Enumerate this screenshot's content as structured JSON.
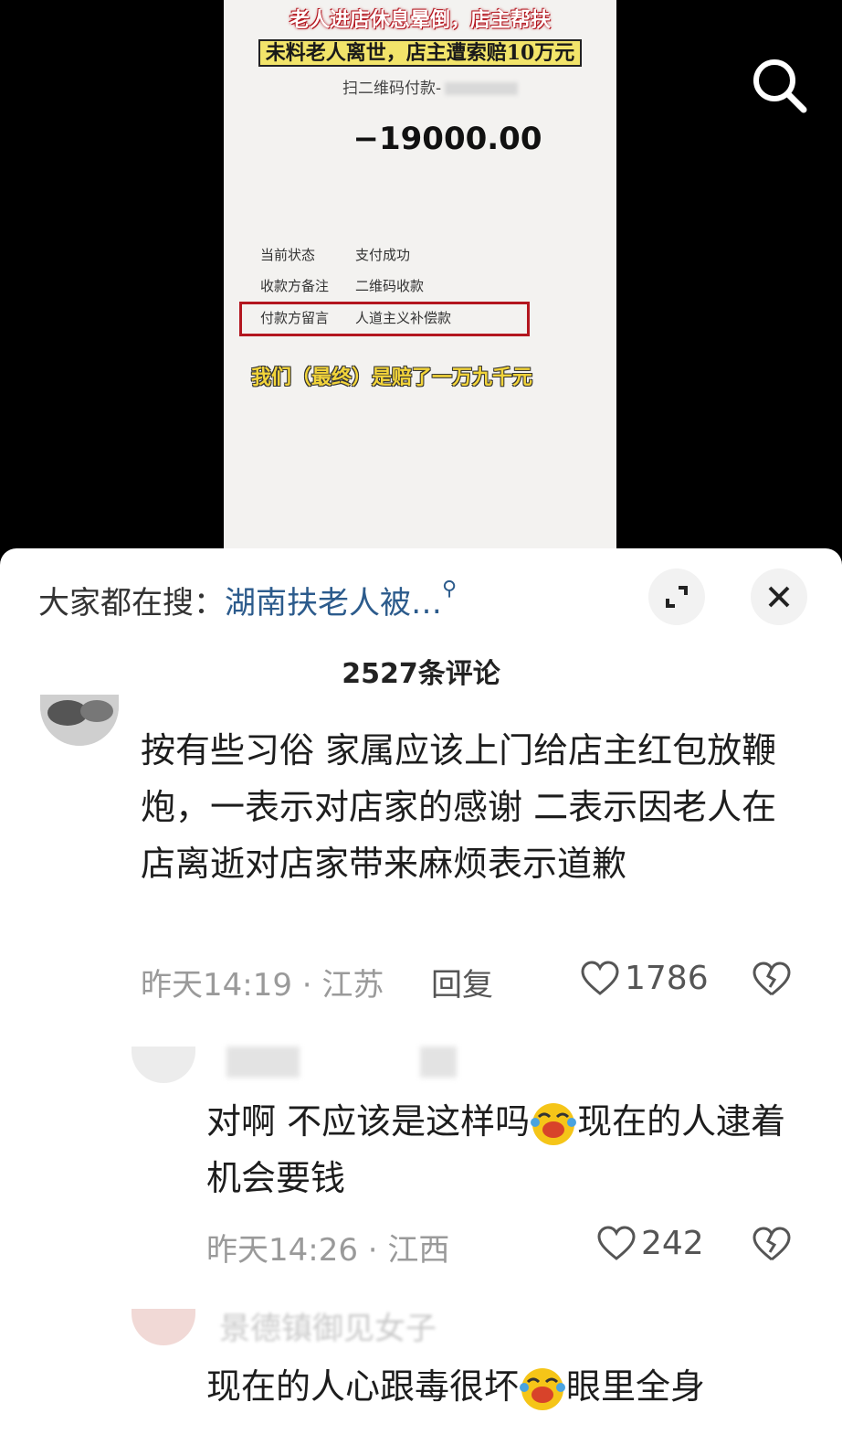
{
  "video": {
    "caption_line1": "老人进店休息晕倒，店主帮扶",
    "caption_line2": "未料老人离世，店主遭索赔10万元",
    "scan_label": "扫二维码付款-",
    "amount": "−19000.00",
    "rows": [
      {
        "key": "当前状态",
        "value": "支付成功"
      },
      {
        "key": "收款方备注",
        "value": "二维码收款"
      },
      {
        "key": "付款方留言",
        "value": "人道主义补偿款"
      }
    ],
    "caption_bottom": "我们（最终）是赔了一万九千元",
    "search_icon": "search-icon"
  },
  "sheet": {
    "suggest_prefix": "大家都在搜：",
    "suggest_keyword": "湖南扶老人被…",
    "comment_count": "2527条评论",
    "comments": [
      {
        "text": "按有些习俗  家属应该上门给店主红包放鞭炮，一表示对店家的感谢  二表示因老人在店离逝对店家带来麻烦表示道歉",
        "time": "昨天14:19 · 江苏",
        "reply": "回复",
        "likes": "1786"
      },
      {
        "text_before": "对啊 不应该是这样吗",
        "text_after": "现在的人逮着机会要钱",
        "time": "昨天14:26 · 江西",
        "likes": "242"
      },
      {
        "name_partial": "景德镇御见女子",
        "text_before": "现在的人心跟毒很坏",
        "text_after": "眼里全身"
      }
    ]
  },
  "colors": {
    "accent_blue": "#2c5b8c",
    "highlight_red": "#b3161f",
    "caption_yellow": "#f2d43a"
  }
}
